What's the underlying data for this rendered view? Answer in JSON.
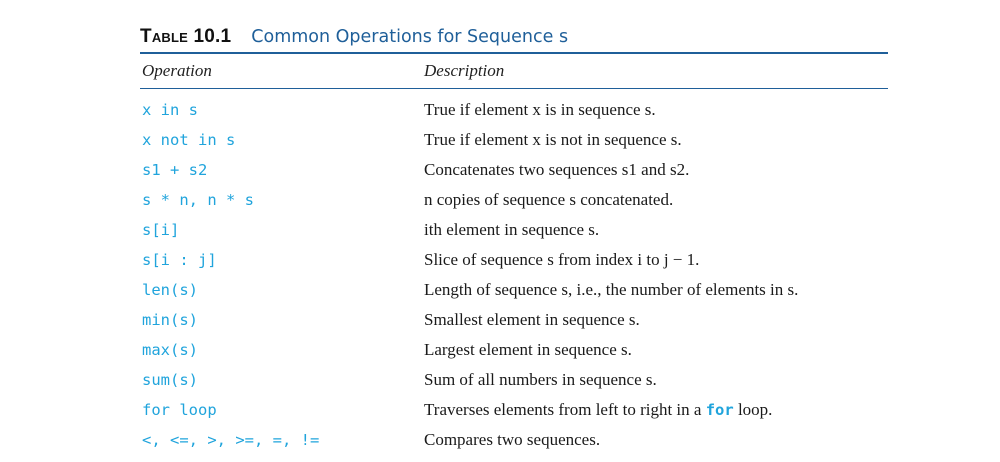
{
  "caption": {
    "label_first": "T",
    "label_rest": "able",
    "label_number": "10.1",
    "title": "Common Operations for Sequence s"
  },
  "header": {
    "operation": "Operation",
    "description": "Description"
  },
  "rows": [
    {
      "operation": "x in s",
      "description": "True if element x is in sequence s."
    },
    {
      "operation": "x not in s",
      "description": "True if element x is not in sequence s."
    },
    {
      "operation": "s1 + s2",
      "description": "Concatenates two sequences s1 and s2."
    },
    {
      "operation": "s * n, n * s",
      "description": "n copies of sequence s concatenated."
    },
    {
      "operation": "s[i]",
      "description": "ith element in sequence s."
    },
    {
      "operation": "s[i : j]",
      "description": "Slice of sequence s from index i to j − 1."
    },
    {
      "operation": "len(s)",
      "description": "Length of sequence s, i.e., the number of elements in s."
    },
    {
      "operation": "min(s)",
      "description": "Smallest element in sequence s."
    },
    {
      "operation": "max(s)",
      "description": "Largest element in sequence s."
    },
    {
      "operation": "sum(s)",
      "description": "Sum of all numbers in sequence s."
    },
    {
      "operation": "for loop",
      "description_before": "Traverses elements from left to right in a ",
      "description_code": "for",
      "description_after": " loop."
    },
    {
      "operation": "<, <=, >, >=, =, !=",
      "description": "Compares two sequences."
    }
  ]
}
